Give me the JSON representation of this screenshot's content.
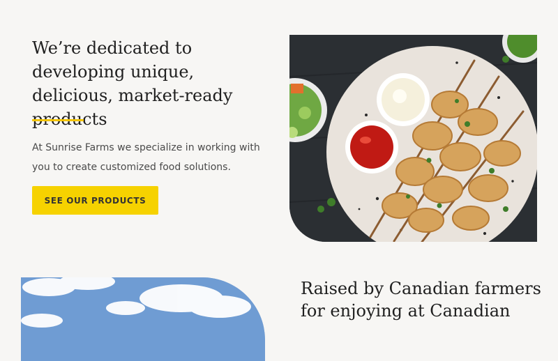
{
  "hero": {
    "headline": "We’re dedicated to developing unique, delicious, market-ready products",
    "description": "At Sunrise Farms we specialize in working with you to create customized food solutions.",
    "cta_label": "SEE OUR PRODUCTS",
    "image": "chicken-skewers-plate-image",
    "accent_color": "#f6d200"
  },
  "section2": {
    "headline": "Raised by Canadian farmers for enjoying at Canadian",
    "image": "sky-clouds-image"
  }
}
